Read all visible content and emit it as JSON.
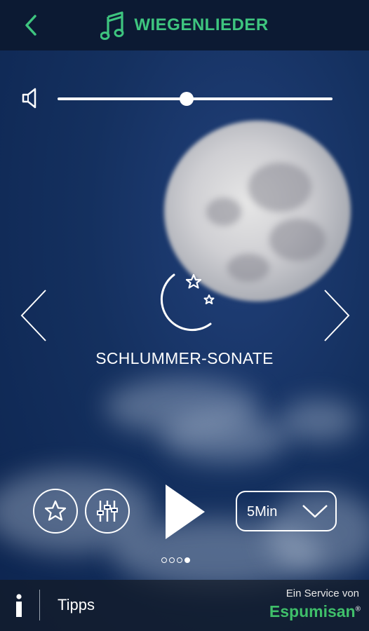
{
  "header": {
    "title": "WIEGENLIEDER",
    "title_icon": "music-note-icon",
    "back_icon": "chevron-left-icon",
    "accent_color": "#3ec57f"
  },
  "volume": {
    "icon": "speaker-icon",
    "level_fraction": 0.47
  },
  "player": {
    "song_title": "SCHLUMMER-SONATE",
    "song_icon": "moon-stars-icon",
    "prev_icon": "chevron-left-icon",
    "next_icon": "chevron-right-icon"
  },
  "controls": {
    "favorite_icon": "star-icon",
    "equalizer_icon": "equalizer-icon",
    "play_icon": "play-icon",
    "timer_value": "5Min",
    "timer_icon": "chevron-down-icon"
  },
  "pager": {
    "count": 4,
    "active_index": 3
  },
  "footer": {
    "info_icon": "info-icon",
    "tips_label": "Tipps",
    "service_label": "Ein Service von",
    "brand": "Espumisan",
    "brand_mark": "®",
    "brand_color": "#3fbf6a"
  }
}
